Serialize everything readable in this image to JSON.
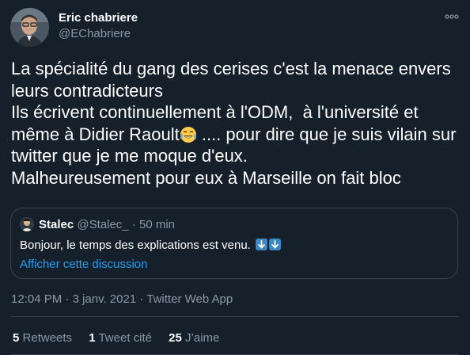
{
  "author": {
    "name": "Eric chabriere",
    "handle": "@EChabriere"
  },
  "tweet": {
    "line1": "La spécialité du gang des cerises c'est la menace envers leurs contradicteurs",
    "line2": "Ils écrivent continuellement à l'ODM,  à l'université et même à Didier Raoult",
    "emoji": "face-with-tears-of-joy",
    "line2b": " .... pour dire que je suis vilain sur twitter que je me moque d'eux.",
    "line3": "Malheureusement pour eux à Marseille on fait bloc"
  },
  "quote": {
    "name": "Stalec",
    "handle": "@Stalec_",
    "separator": "·",
    "time": "50 min",
    "text": "Bonjour, le temps des explications est venu.",
    "arrows": [
      "down-arrow",
      "down-arrow"
    ],
    "link": "Afficher cette discussion"
  },
  "meta": {
    "time": "12:04 PM",
    "dot": "·",
    "date": "3 janv. 2021",
    "source": "Twitter Web App"
  },
  "stats": {
    "retweets_count": "5",
    "retweets_label": "Retweets",
    "quotes_count": "1",
    "quotes_label": "Tweet cité",
    "likes_count": "25",
    "likes_label": "J’aime"
  },
  "colors": {
    "background": "#15202b",
    "text": "#ffffff",
    "secondary": "#8b98a5",
    "link": "#1da1f2",
    "border": "#38444d",
    "arrow_box": "#3b88c3"
  }
}
